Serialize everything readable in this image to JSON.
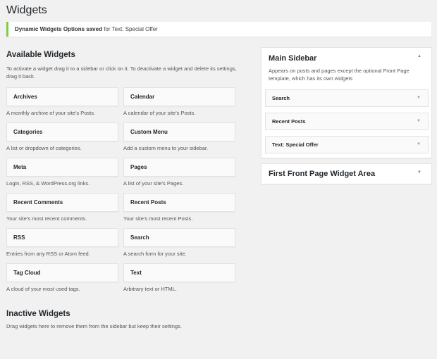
{
  "page": {
    "title": "Widgets"
  },
  "notice": {
    "strong": "Dynamic Widgets Options saved",
    "rest": " for Text: Special Offer"
  },
  "available": {
    "title": "Available Widgets",
    "description": "To activate a widget drag it to a sidebar or click on it. To deactivate a widget and delete its settings, drag it back.",
    "widgets": [
      {
        "name": "Archives",
        "desc": "A monthly archive of your site's Posts."
      },
      {
        "name": "Calendar",
        "desc": "A calendar of your site's Posts."
      },
      {
        "name": "Categories",
        "desc": "A list or dropdown of categories."
      },
      {
        "name": "Custom Menu",
        "desc": "Add a custom menu to your sidebar."
      },
      {
        "name": "Meta",
        "desc": "Login, RSS, & WordPress.org links."
      },
      {
        "name": "Pages",
        "desc": "A list of your site's Pages."
      },
      {
        "name": "Recent Comments",
        "desc": "Your site's most recent comments."
      },
      {
        "name": "Recent Posts",
        "desc": "Your site's most recent Posts."
      },
      {
        "name": "RSS",
        "desc": "Entries from any RSS or Atom feed."
      },
      {
        "name": "Search",
        "desc": "A search form for your site."
      },
      {
        "name": "Tag Cloud",
        "desc": "A cloud of your most used tags."
      },
      {
        "name": "Text",
        "desc": "Arbitrary text or HTML."
      }
    ]
  },
  "inactive": {
    "title": "Inactive Widgets",
    "description": "Drag widgets here to remove them from the sidebar but keep their settings."
  },
  "sidebars": {
    "main": {
      "title": "Main Sidebar",
      "toggle_icon": "▲",
      "description": "Appears on posts and pages except the optional Front Page template, which has its own widgets",
      "widgets": [
        {
          "name": "Search"
        },
        {
          "name": "Recent Posts"
        },
        {
          "name": "Text: Special Offer"
        }
      ]
    },
    "front": {
      "title": "First Front Page Widget Area",
      "toggle_icon": "▼"
    }
  },
  "icons": {
    "widget_arrow": "▼"
  },
  "colors": {
    "notice_border": "#7ad03a",
    "background": "#f1f1f1"
  }
}
